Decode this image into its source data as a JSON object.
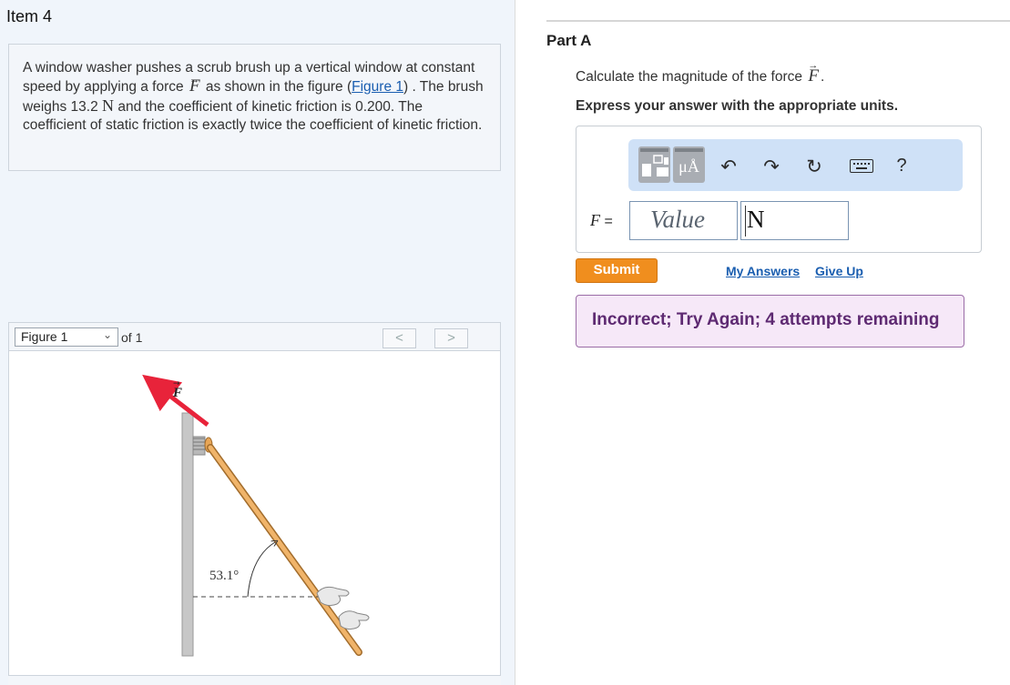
{
  "item_title": "Item 4",
  "problem": {
    "t1": "A window washer pushes a scrub brush up a vertical window at constant speed by applying a force ",
    "force_symbol": "F",
    "t2": " as shown in the figure (",
    "figure_link": "Figure 1",
    "t3": ") . The brush weighs 13.2 ",
    "weight_unit": "N",
    "t4": " and the coefficient of kinetic friction is 0.200. The coefficient of static friction is exactly twice the coefficient of kinetic friction."
  },
  "figure": {
    "select_value": "Figure 1",
    "of_label": "of 1",
    "prev_label": "<",
    "next_label": ">",
    "force_label": "F",
    "angle_label": "53.1°",
    "colors": {
      "force_arrow": "#e8233a",
      "pole": "#e8a657",
      "wall": "#c7c7c7"
    }
  },
  "part": {
    "title": "Part A",
    "question_prefix": "Calculate the magnitude of the force ",
    "question_symbol": "F",
    "question_suffix": ".",
    "instruction": "Express your answer with the appropriate units."
  },
  "toolbar": {
    "template_icon": "template-icon",
    "units_label": "μÅ",
    "undo_icon": "undo-icon",
    "redo_icon": "redo-icon",
    "reset_icon": "reset-icon",
    "keyboard_icon": "keyboard-icon",
    "help_label": "?"
  },
  "answer": {
    "label_symbol": "F",
    "label_eq": " =",
    "value_placeholder": "Value",
    "unit_value": "N"
  },
  "actions": {
    "submit": "Submit",
    "my_answers": "My Answers",
    "give_up": "Give Up"
  },
  "feedback": "Incorrect; Try Again; 4 attempts remaining",
  "colors": {
    "submit": "#f08e1e",
    "link": "#1a5eb0",
    "feedback_bg": "#f6e8f8",
    "feedback_text": "#5e2a72"
  }
}
